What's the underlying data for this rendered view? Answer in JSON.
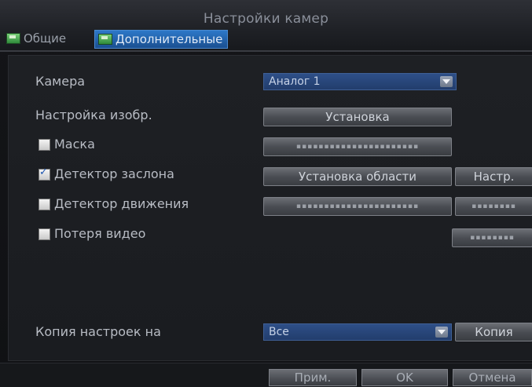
{
  "window": {
    "title": "Настройки камер"
  },
  "tabs": [
    {
      "label": "Общие",
      "active": false
    },
    {
      "label": "Дополнительные",
      "active": true
    }
  ],
  "rows": {
    "camera": {
      "label": "Камера",
      "value": "Аналог 1"
    },
    "image": {
      "label": "Настройка изобр.",
      "button": "Установка"
    },
    "mask": {
      "label": "Маска",
      "checked": false
    },
    "tamper": {
      "label": "Детектор заслона",
      "checked": true,
      "button_area": "Установка области",
      "button_setup": "Настр."
    },
    "motion": {
      "label": "Детектор движения",
      "checked": false
    },
    "videoloss": {
      "label": "Потеря видео",
      "checked": false
    },
    "copy": {
      "label": "Копия настроек на",
      "value": "Все",
      "button": "Копия"
    }
  },
  "footer": {
    "apply": "Прим.",
    "ok": "OK",
    "cancel": "Отмена"
  },
  "colors": {
    "accent": "#2d78c8",
    "select_bg": "#2e4f88",
    "background": "#1e2024"
  }
}
